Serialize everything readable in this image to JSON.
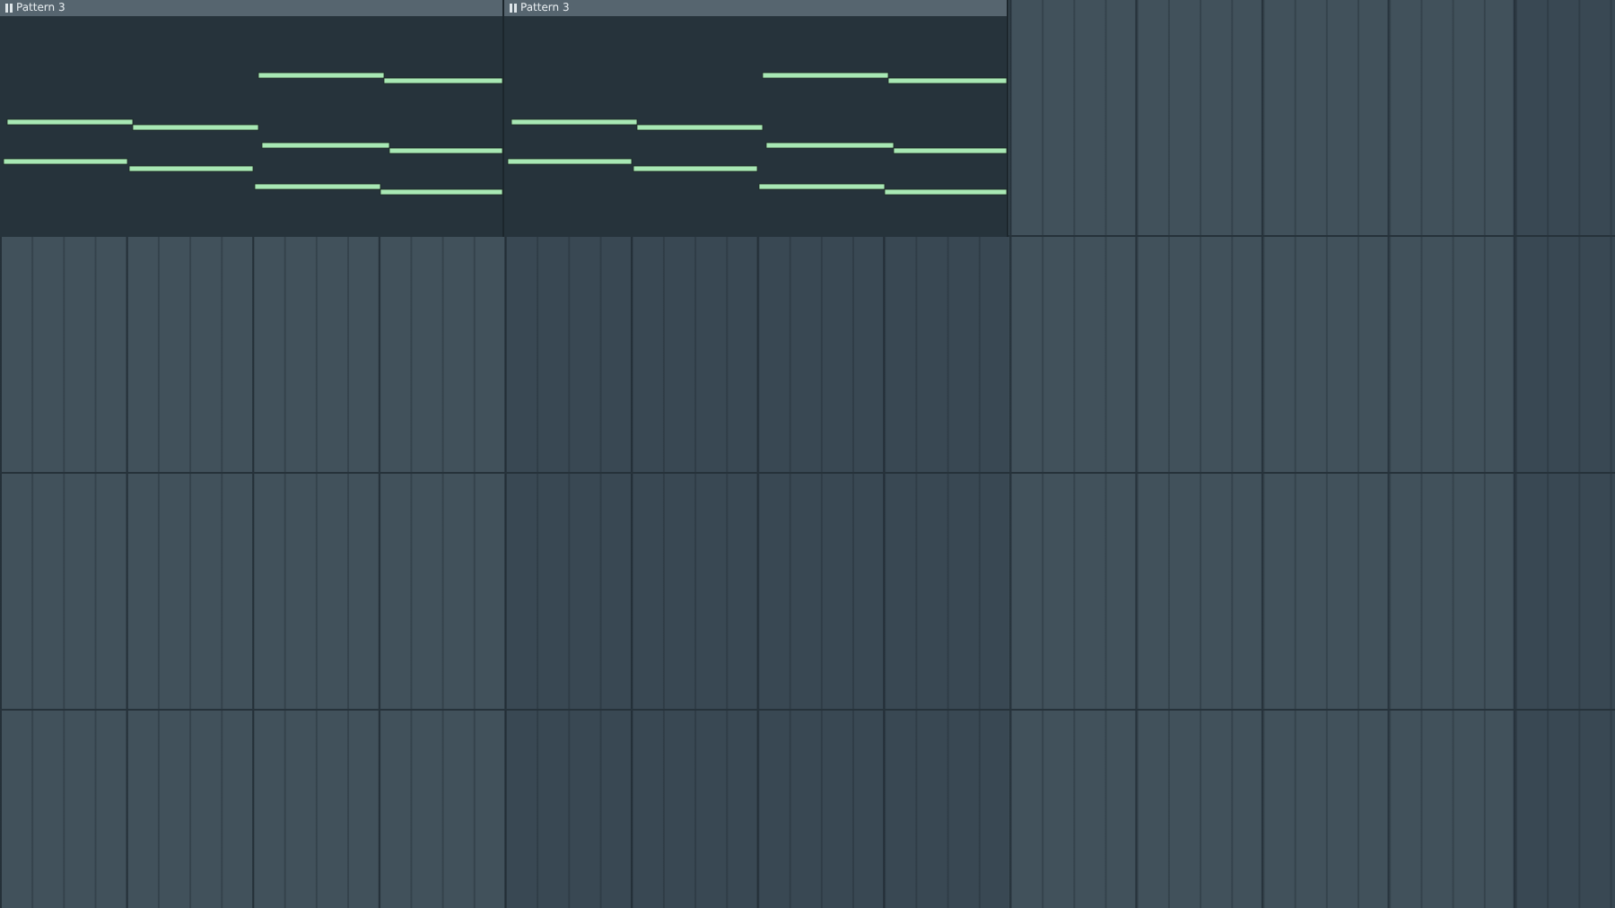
{
  "playlist": {
    "clips": [
      {
        "label": "Pattern 3"
      },
      {
        "label": "Pattern 3"
      }
    ]
  }
}
